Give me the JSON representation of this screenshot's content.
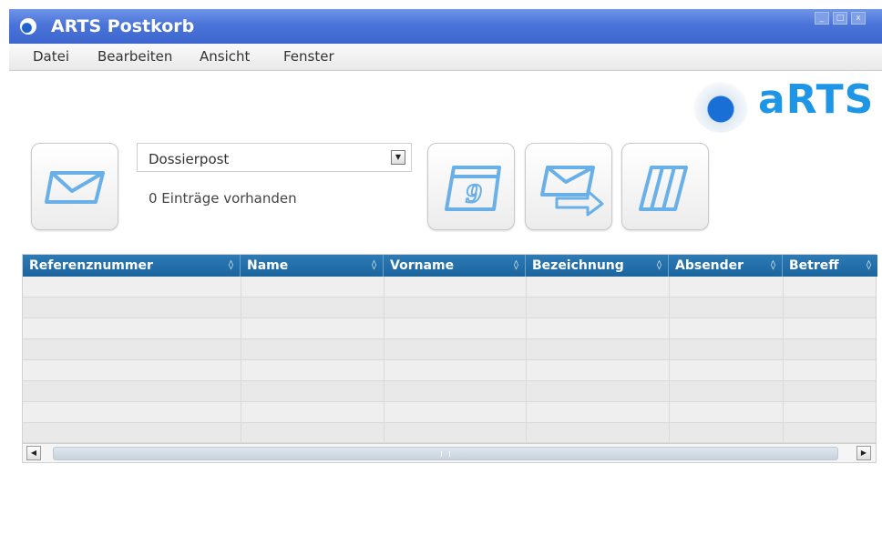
{
  "window": {
    "title": "ARTS Postkorb",
    "controls": [
      "_",
      "□",
      "x"
    ]
  },
  "menu": [
    "Datei",
    "Bearbeiten",
    "Ansicht",
    "Fenster"
  ],
  "logo": {
    "text": "aRTS",
    "color": "#1f95e6"
  },
  "toolbar": {
    "mail_button_icon": "envelope-icon",
    "mailbox_select": {
      "value": "Dossierpost"
    },
    "entries_label": "0 Einträge vorhanden",
    "calendar_button_icon": "calendar-icon",
    "forward_button_icon": "forward-mail-icon",
    "archive_button_icon": "archive-icon"
  },
  "table": {
    "header_color": "#1c659f",
    "columns": [
      "Referenznummer",
      "Name",
      "Vorname",
      "Bezeichnung",
      "Absender",
      "Betreff"
    ],
    "sort_glyph": "◊",
    "rows": []
  },
  "colors": {
    "titlebar": "#4a74d8",
    "accent_icon": "#6ab0e8"
  }
}
